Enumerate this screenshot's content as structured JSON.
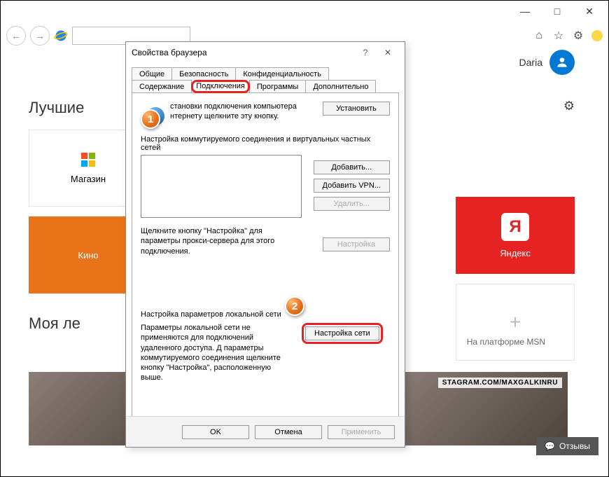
{
  "window": {
    "min": "—",
    "max": "□",
    "close": "✕"
  },
  "browser": {
    "back": "←",
    "fwd": "→",
    "home": "⌂",
    "star": "☆",
    "gear": "⚙"
  },
  "user": {
    "name": "Daria"
  },
  "page": {
    "section_best": "Лучшие",
    "section_feed": "Моя ле",
    "platform": "На платформе MSN",
    "feedback": "Отзывы"
  },
  "tiles": {
    "store": "Магазин",
    "kino": "Кино",
    "yandex": "Яндекс",
    "ya_letter": "Я"
  },
  "feed": {
    "tag": "STAGRAM.COM/MAXGALKINRU"
  },
  "dialog": {
    "title": "Свойства браузера",
    "help": "?",
    "close": "✕",
    "tabs": {
      "general": "Общие",
      "security": "Безопасность",
      "privacy": "Конфиденциальность",
      "content": "Содержание",
      "connections": "Подключения",
      "programs": "Программы",
      "advanced": "Дополнительно"
    },
    "setup_text": "становки подключения компьютера нтернету щелкните эту кнопку.",
    "setup_btn": "Установить",
    "dial_label": "Настройка коммутируемого соединения и виртуальных частных сетей",
    "add_btn": "Добавить...",
    "add_vpn_btn": "Добавить VPN...",
    "del_btn": "Удалить...",
    "settings_btn": "Настройка",
    "proxy_hint": "Щелкните кнопку \"Настройка\" для параметры прокси-сервера для этого подключения.",
    "lan_label": "Настройка параметров локальной сети",
    "lan_text": "Параметры локальной сети не применяются для подключений удаленного доступа. Д параметры коммутируемого соединения щелкните кнопку \"Настройка\", расположенную выше.",
    "lan_btn": "Настройка сети",
    "ok": "OK",
    "cancel": "Отмена",
    "apply": "Применить"
  },
  "callouts": {
    "one": "1",
    "two": "2"
  }
}
